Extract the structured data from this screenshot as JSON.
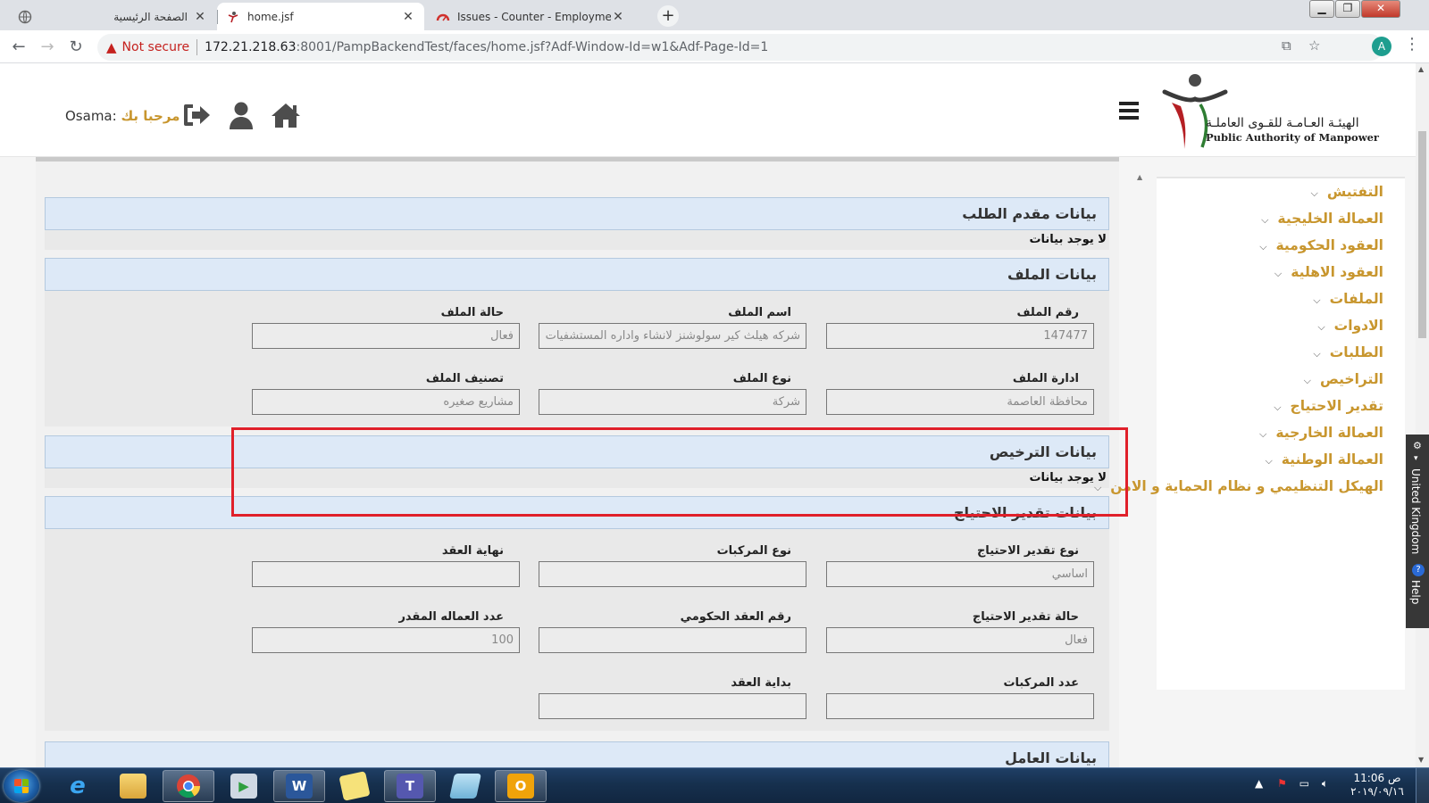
{
  "browser": {
    "tabs": [
      {
        "title": "الصفحة الرئيسية",
        "active": false
      },
      {
        "title": "home.jsf",
        "active": true
      },
      {
        "title": "Issues - Counter - Employment - ...",
        "active": false
      }
    ],
    "new_tab_symbol": "+",
    "security_label": "Not secure",
    "url_host": "172.21.218.63",
    "url_rest": ":8001/PampBackendTest/faces/home.jsf?Adf-Window-Id=w1&Adf-Page-Id=1",
    "profile_initial": "A"
  },
  "header": {
    "logo_ar": "الهيئـة العـامـة للقـوى العاملـة",
    "logo_en": "Public Authority of Manpower",
    "welcome_user": "Osama:",
    "welcome_greeting": "مرحبا بك",
    "icons": [
      "logout-icon",
      "user-icon",
      "home-icon"
    ]
  },
  "sections": {
    "applicant": {
      "title": "بيانات مقدم الطلب",
      "nodata": "لا يوجد بيانات"
    },
    "file": {
      "title": "بيانات الملف",
      "fields": [
        {
          "label": "رقم الملف",
          "value": "147477"
        },
        {
          "label": "اسم الملف",
          "value": "شركه هيلث كير سولوشنز لانشاء واداره المستشفيات"
        },
        {
          "label": "حالة الملف",
          "value": "فعال"
        },
        {
          "label": "ادارة الملف",
          "value": "محافظة العاصمة"
        },
        {
          "label": "نوع الملف",
          "value": "شركة"
        },
        {
          "label": "تصنيف الملف",
          "value": "مشاريع صغيره"
        }
      ]
    },
    "license": {
      "title": "بيانات الترخيص",
      "nodata": "لا يوجد بيانات"
    },
    "needs": {
      "title": "بيانات تقدير الاحتياج",
      "fields": [
        {
          "label": "نوع تقدير الاحتياج",
          "value": "اساسي"
        },
        {
          "label": "نوع المركبات",
          "value": ""
        },
        {
          "label": "نهاية العقد",
          "value": ""
        },
        {
          "label": "حالة تقدير الاحتياج",
          "value": "فعال"
        },
        {
          "label": "رقم العقد الحكومي",
          "value": ""
        },
        {
          "label": "عدد العماله المقدر",
          "value": "100"
        },
        {
          "label": "عدد المركبات",
          "value": ""
        },
        {
          "label": "بداية العقد",
          "value": ""
        }
      ]
    },
    "workers": {
      "title": "بيانات العامل"
    }
  },
  "sidebar": {
    "items": [
      "التفتيش",
      "العمالة الخليجية",
      "العقود الحكومية",
      "العقود الاهلية",
      "الملفات",
      "الادوات",
      "الطلبات",
      "التراخيص",
      "تقدير الاحتياج",
      "العمالة الخارجية",
      "العمالة الوطنية",
      "الهيكل التنظيمي و نظام الحماية و الامن"
    ]
  },
  "translate_widget": {
    "label": "United Kingdom",
    "help": "Help"
  },
  "taskbar": {
    "apps": [
      "internet-explorer",
      "file-explorer",
      "chrome",
      "media-center",
      "word",
      "sticky-notes",
      "teams",
      "notepad",
      "outlook"
    ],
    "clock_time": "11:06 ص",
    "clock_date": "٢٠١٩/٠٩/١٦"
  },
  "colors": {
    "accent_gold": "#c8962e",
    "section_blue": "#dde9f7",
    "highlight_red": "#e0202a"
  }
}
